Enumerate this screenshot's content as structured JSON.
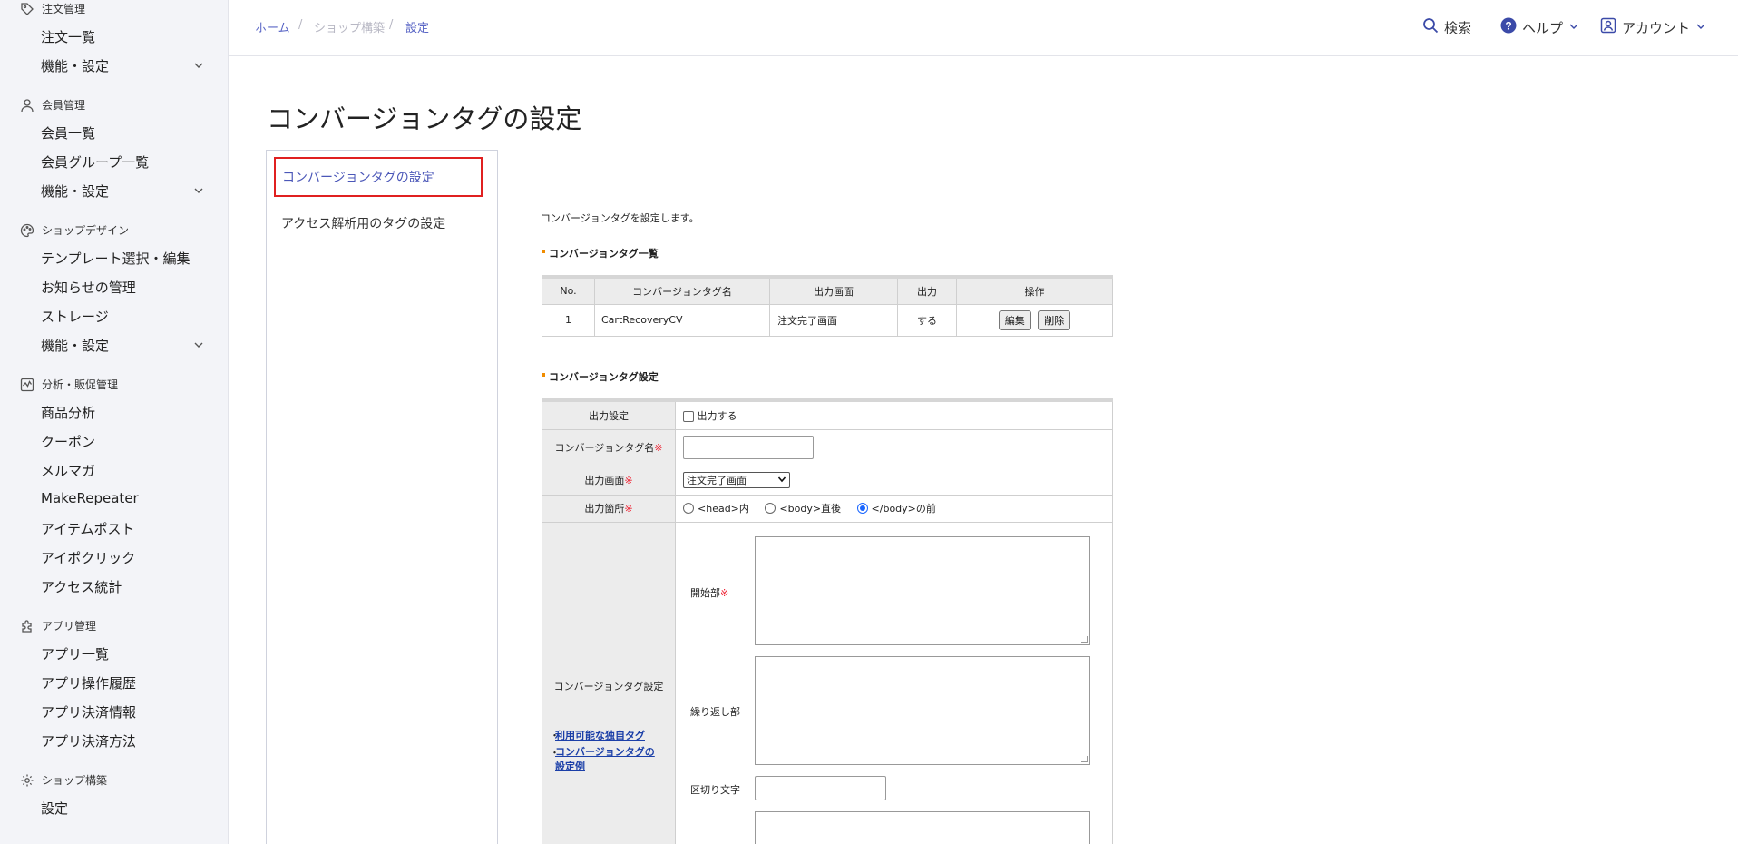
{
  "sidebar": {
    "sections": [
      {
        "label": "注文管理",
        "icon": "tag-icon",
        "items": [
          {
            "label": "注文一覧"
          },
          {
            "label": "機能・設定",
            "expand": true
          }
        ]
      },
      {
        "label": "会員管理",
        "icon": "user-icon",
        "items": [
          {
            "label": "会員一覧"
          },
          {
            "label": "会員グループ一覧"
          },
          {
            "label": "機能・設定",
            "expand": true
          }
        ]
      },
      {
        "label": "ショップデザイン",
        "icon": "palette-icon",
        "items": [
          {
            "label": "テンプレート選択・編集"
          },
          {
            "label": "お知らせの管理"
          },
          {
            "label": "ストレージ"
          },
          {
            "label": "機能・設定",
            "expand": true
          }
        ]
      },
      {
        "label": "分析・販促管理",
        "icon": "chart-icon",
        "items": [
          {
            "label": "商品分析"
          },
          {
            "label": "クーポン"
          },
          {
            "label": "メルマガ"
          },
          {
            "label": "MakeRepeater"
          },
          {
            "label": "アイテムポスト"
          },
          {
            "label": "アイポクリック"
          },
          {
            "label": "アクセス統計"
          }
        ]
      },
      {
        "label": "アプリ管理",
        "icon": "puzzle-icon",
        "items": [
          {
            "label": "アプリ一覧"
          },
          {
            "label": "アプリ操作履歴"
          },
          {
            "label": "アプリ決済情報"
          },
          {
            "label": "アプリ決済方法"
          }
        ]
      },
      {
        "label": "ショップ構築",
        "icon": "gear-icon",
        "items": [
          {
            "label": "設定"
          }
        ]
      }
    ]
  },
  "header": {
    "breadcrumb": [
      "ホーム",
      "ショップ構築",
      "設定"
    ],
    "search_label": "検索",
    "help_label": "ヘルプ",
    "account_label": "アカウント"
  },
  "page_title": "コンバージョンタグの設定",
  "submenu": {
    "active": "コンバージョンタグの設定",
    "other": "アクセス解析用のタグの設定"
  },
  "main": {
    "description": "コンバージョンタグを設定します。",
    "list_title": "コンバージョンタグ一覧",
    "list_headers": [
      "No.",
      "コンバージョンタグ名",
      "出力画面",
      "出力",
      "操作"
    ],
    "list_rows": [
      {
        "no": "1",
        "name": "CartRecoveryCV",
        "screen": "注文完了画面",
        "output": "する",
        "edit": "編集",
        "delete": "削除"
      }
    ],
    "form_title": "コンバージョンタグ設定",
    "form": {
      "output_setting_label": "出力設定",
      "output_checkbox_label": "出力する",
      "tag_name_label": "コンバージョンタグ名",
      "required_mark": "※",
      "screen_label": "出力画面",
      "screen_selected": "注文完了画面",
      "position_label": "出力箇所",
      "position_options": [
        "<head>内",
        "<body>直後",
        "</body>の前"
      ],
      "position_selected_index": 2,
      "tag_setting_label": "コンバージョンタグ設定",
      "link_available_tags": "利用可能な独自タグ",
      "link_examples": "コンバージョンタグの設定例",
      "start_label": "開始部",
      "repeat_label": "繰り返し部",
      "separator_label": "区切り文字"
    }
  },
  "colors": {
    "accent": "#5b67c6",
    "highlight_border": "#e02020",
    "required": "#ee2233",
    "section_marker": "#f08c00",
    "radio_selected": "#1a66ff"
  }
}
